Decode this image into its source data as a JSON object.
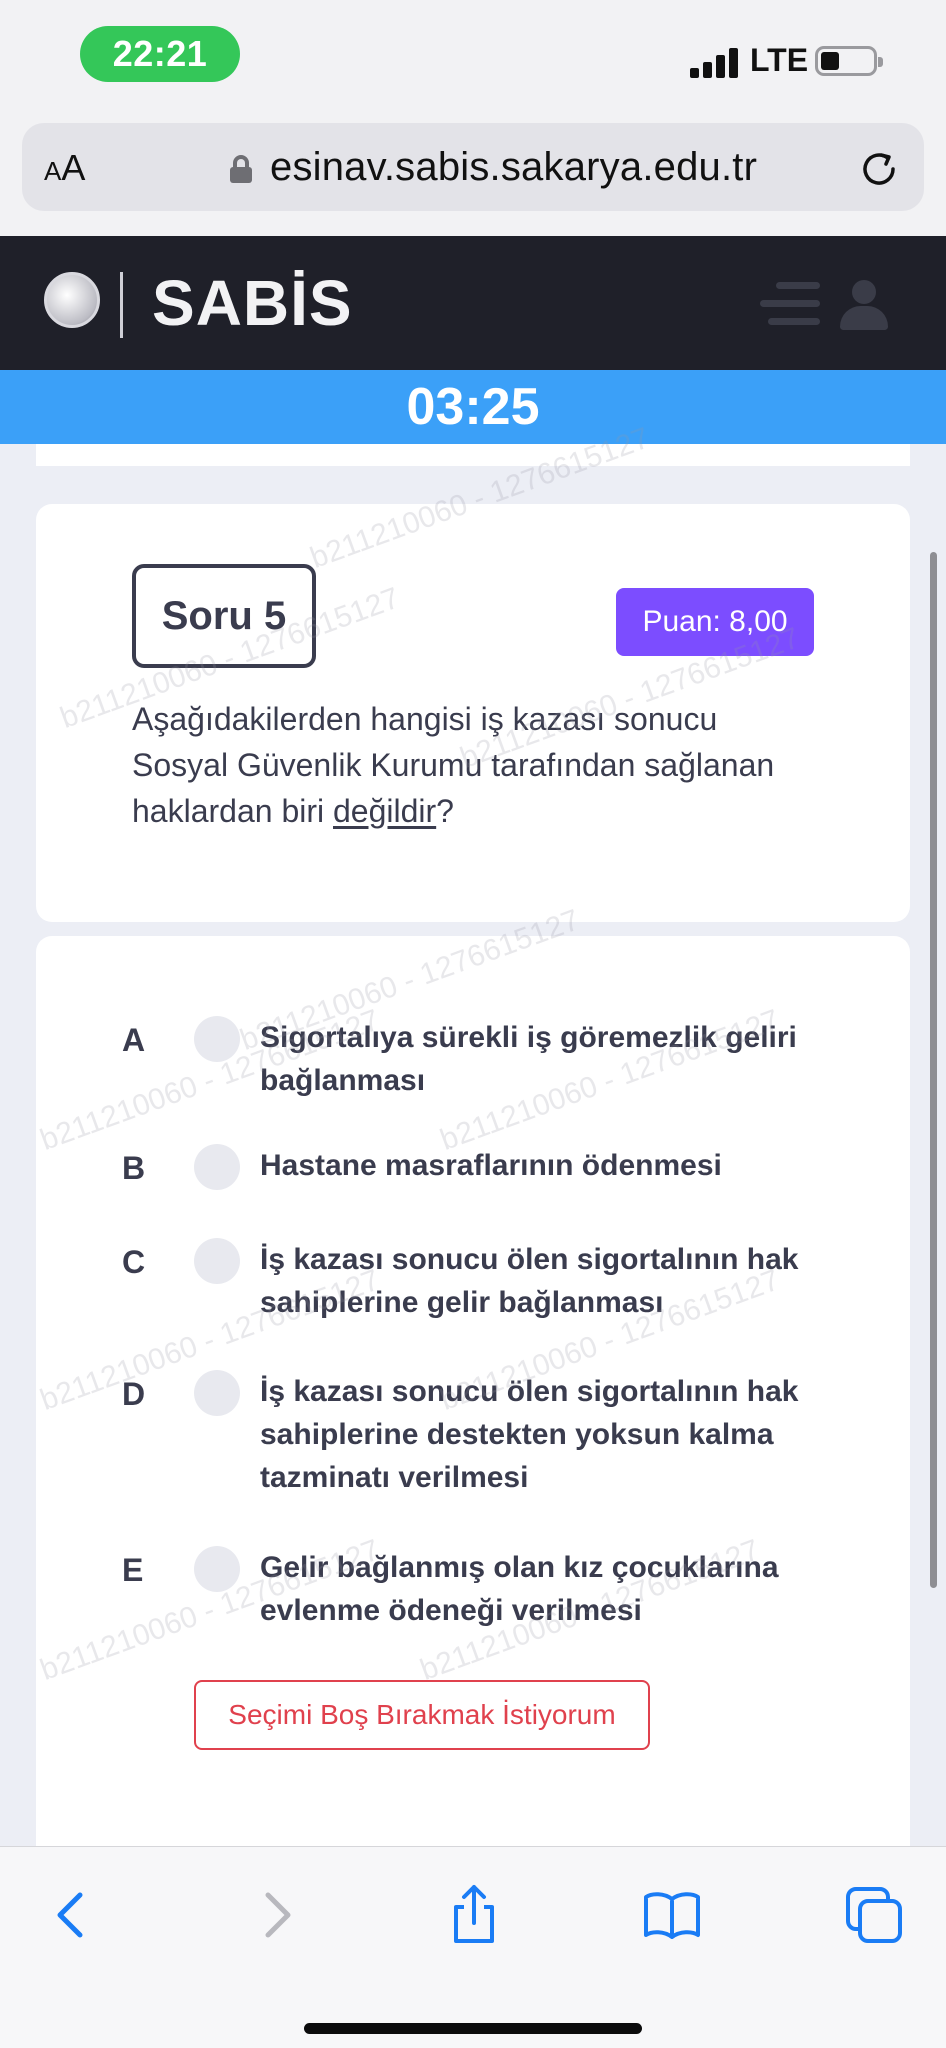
{
  "status_bar": {
    "time": "22:21",
    "network": "LTE",
    "icons": [
      "signal-icon",
      "battery-icon"
    ]
  },
  "browser": {
    "text_size_label_small": "A",
    "text_size_label_large": "A",
    "url": "esinav.sabis.sakarya.edu.tr",
    "icons": [
      "lock-icon",
      "reload-icon"
    ]
  },
  "header": {
    "brand": "SABİS",
    "icons": [
      "sabis-logo-icon",
      "menu-icon",
      "user-icon"
    ]
  },
  "timer": "03:25",
  "question": {
    "label": "Soru 5",
    "points": "Puan: 8,00",
    "text_part1": "Aşağıdakilerden hangisi iş kazası sonucu Sosyal Güvenlik Kurumu tarafından sağlanan haklardan biri ",
    "text_underlined": "değildir",
    "text_end": "?"
  },
  "options": [
    {
      "letter": "A",
      "text": "Sigortalıya sürekli iş göremezlik geliri bağlanması"
    },
    {
      "letter": "B",
      "text": "Hastane masraflarının ödenmesi"
    },
    {
      "letter": "C",
      "text": "İş kazası sonucu ölen sigortalının hak sahiplerine gelir bağlanması"
    },
    {
      "letter": "D",
      "text": "İş kazası sonucu ölen sigortalının hak sahiplerine destekten yoksun kalma tazminatı verilmesi"
    },
    {
      "letter": "E",
      "text": "Gelir bağlanmış olan kız çocuklarına evlenme ödeneği verilmesi"
    }
  ],
  "skip_button": "Seçimi Boş Bırakmak İstiyorum",
  "watermark": "b211210060 - 1276615127",
  "toolbar": {
    "icons": [
      "back-icon",
      "forward-icon",
      "share-icon",
      "bookmarks-icon",
      "tabs-icon"
    ]
  },
  "colors": {
    "timer": "#3ba0f8",
    "header": "#1f2029",
    "points_badge": "#7c4dff",
    "skip_button": "#e0414d",
    "status_time_pill": "#34c759"
  }
}
